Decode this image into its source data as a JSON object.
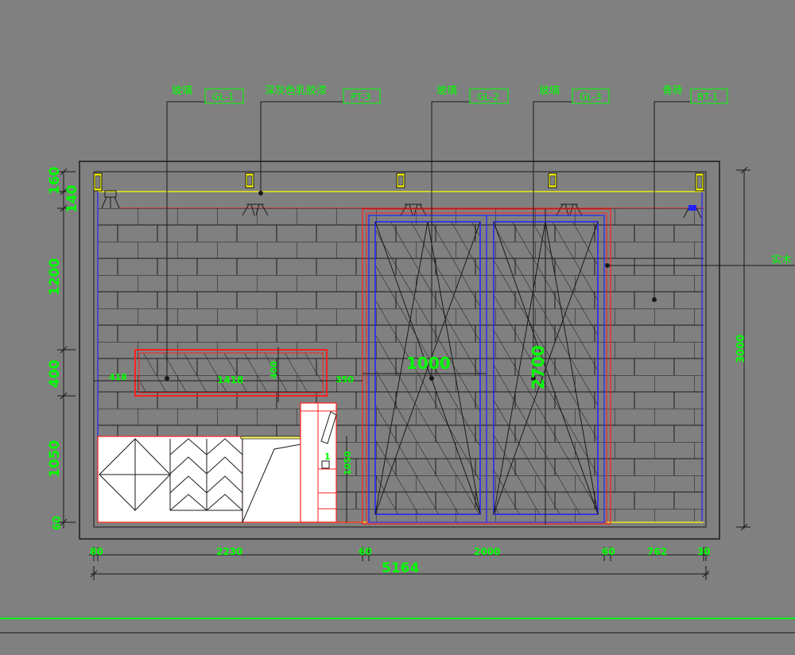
{
  "colors": {
    "background": "#808080",
    "dimension": "#00ff00",
    "outline": "#1a1a1a",
    "red": "#ff2020",
    "blue": "#2020ff",
    "yellow": "#ffff00",
    "white": "#ffffff"
  },
  "material_labels": [
    {
      "name": "玻璃",
      "code": "GL-1"
    },
    {
      "name": "深灰色乳胶漆",
      "code": "PT-3"
    },
    {
      "name": "玻璃",
      "code": "GL-2"
    },
    {
      "name": "玻璃",
      "code": "GL-3"
    },
    {
      "name": "青砖",
      "code": "BT-1"
    }
  ],
  "side_label": "实木",
  "left_dims": [
    "160",
    "140",
    "1200",
    "400",
    "1050",
    "60"
  ],
  "right_dim": "3000",
  "bottom_dims": [
    "80",
    "2230",
    "60",
    "2000",
    "60",
    "762",
    "30"
  ],
  "total_width": "5164",
  "window": {
    "left": "418",
    "width": "1418",
    "height": "400",
    "right": "350"
  },
  "door": {
    "width": "1000",
    "height": "2700"
  },
  "counter_dim": "1050",
  "cabinet_mark": "1"
}
